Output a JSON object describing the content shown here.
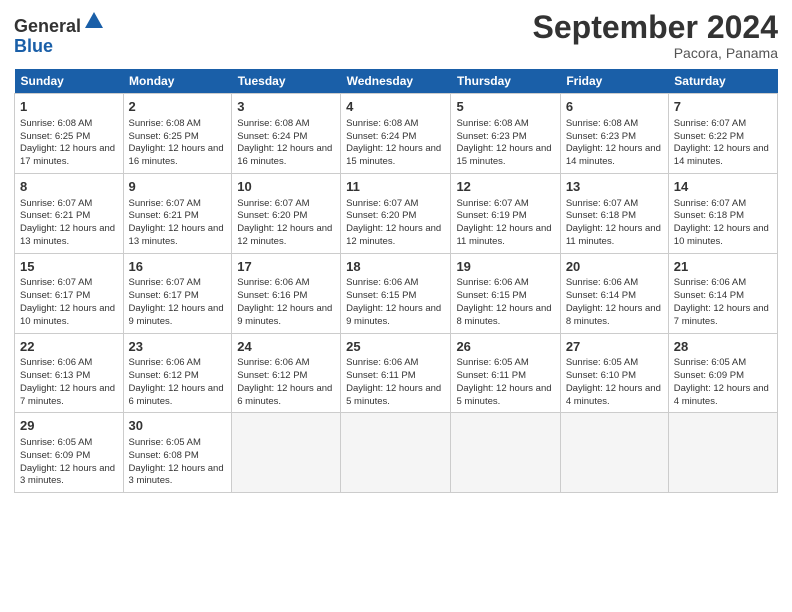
{
  "header": {
    "logo_general": "General",
    "logo_blue": "Blue",
    "month_title": "September 2024",
    "location": "Pacora, Panama"
  },
  "days_of_week": [
    "Sunday",
    "Monday",
    "Tuesday",
    "Wednesday",
    "Thursday",
    "Friday",
    "Saturday"
  ],
  "weeks": [
    [
      {
        "day": "1",
        "sunrise": "6:08 AM",
        "sunset": "6:25 PM",
        "daylight": "12 hours and 17 minutes."
      },
      {
        "day": "2",
        "sunrise": "6:08 AM",
        "sunset": "6:25 PM",
        "daylight": "12 hours and 16 minutes."
      },
      {
        "day": "3",
        "sunrise": "6:08 AM",
        "sunset": "6:24 PM",
        "daylight": "12 hours and 16 minutes."
      },
      {
        "day": "4",
        "sunrise": "6:08 AM",
        "sunset": "6:24 PM",
        "daylight": "12 hours and 15 minutes."
      },
      {
        "day": "5",
        "sunrise": "6:08 AM",
        "sunset": "6:23 PM",
        "daylight": "12 hours and 15 minutes."
      },
      {
        "day": "6",
        "sunrise": "6:08 AM",
        "sunset": "6:23 PM",
        "daylight": "12 hours and 14 minutes."
      },
      {
        "day": "7",
        "sunrise": "6:07 AM",
        "sunset": "6:22 PM",
        "daylight": "12 hours and 14 minutes."
      }
    ],
    [
      {
        "day": "8",
        "sunrise": "6:07 AM",
        "sunset": "6:21 PM",
        "daylight": "12 hours and 13 minutes."
      },
      {
        "day": "9",
        "sunrise": "6:07 AM",
        "sunset": "6:21 PM",
        "daylight": "12 hours and 13 minutes."
      },
      {
        "day": "10",
        "sunrise": "6:07 AM",
        "sunset": "6:20 PM",
        "daylight": "12 hours and 12 minutes."
      },
      {
        "day": "11",
        "sunrise": "6:07 AM",
        "sunset": "6:20 PM",
        "daylight": "12 hours and 12 minutes."
      },
      {
        "day": "12",
        "sunrise": "6:07 AM",
        "sunset": "6:19 PM",
        "daylight": "12 hours and 11 minutes."
      },
      {
        "day": "13",
        "sunrise": "6:07 AM",
        "sunset": "6:18 PM",
        "daylight": "12 hours and 11 minutes."
      },
      {
        "day": "14",
        "sunrise": "6:07 AM",
        "sunset": "6:18 PM",
        "daylight": "12 hours and 10 minutes."
      }
    ],
    [
      {
        "day": "15",
        "sunrise": "6:07 AM",
        "sunset": "6:17 PM",
        "daylight": "12 hours and 10 minutes."
      },
      {
        "day": "16",
        "sunrise": "6:07 AM",
        "sunset": "6:17 PM",
        "daylight": "12 hours and 9 minutes."
      },
      {
        "day": "17",
        "sunrise": "6:06 AM",
        "sunset": "6:16 PM",
        "daylight": "12 hours and 9 minutes."
      },
      {
        "day": "18",
        "sunrise": "6:06 AM",
        "sunset": "6:15 PM",
        "daylight": "12 hours and 9 minutes."
      },
      {
        "day": "19",
        "sunrise": "6:06 AM",
        "sunset": "6:15 PM",
        "daylight": "12 hours and 8 minutes."
      },
      {
        "day": "20",
        "sunrise": "6:06 AM",
        "sunset": "6:14 PM",
        "daylight": "12 hours and 8 minutes."
      },
      {
        "day": "21",
        "sunrise": "6:06 AM",
        "sunset": "6:14 PM",
        "daylight": "12 hours and 7 minutes."
      }
    ],
    [
      {
        "day": "22",
        "sunrise": "6:06 AM",
        "sunset": "6:13 PM",
        "daylight": "12 hours and 7 minutes."
      },
      {
        "day": "23",
        "sunrise": "6:06 AM",
        "sunset": "6:12 PM",
        "daylight": "12 hours and 6 minutes."
      },
      {
        "day": "24",
        "sunrise": "6:06 AM",
        "sunset": "6:12 PM",
        "daylight": "12 hours and 6 minutes."
      },
      {
        "day": "25",
        "sunrise": "6:06 AM",
        "sunset": "6:11 PM",
        "daylight": "12 hours and 5 minutes."
      },
      {
        "day": "26",
        "sunrise": "6:05 AM",
        "sunset": "6:11 PM",
        "daylight": "12 hours and 5 minutes."
      },
      {
        "day": "27",
        "sunrise": "6:05 AM",
        "sunset": "6:10 PM",
        "daylight": "12 hours and 4 minutes."
      },
      {
        "day": "28",
        "sunrise": "6:05 AM",
        "sunset": "6:09 PM",
        "daylight": "12 hours and 4 minutes."
      }
    ],
    [
      {
        "day": "29",
        "sunrise": "6:05 AM",
        "sunset": "6:09 PM",
        "daylight": "12 hours and 3 minutes."
      },
      {
        "day": "30",
        "sunrise": "6:05 AM",
        "sunset": "6:08 PM",
        "daylight": "12 hours and 3 minutes."
      },
      null,
      null,
      null,
      null,
      null
    ]
  ]
}
